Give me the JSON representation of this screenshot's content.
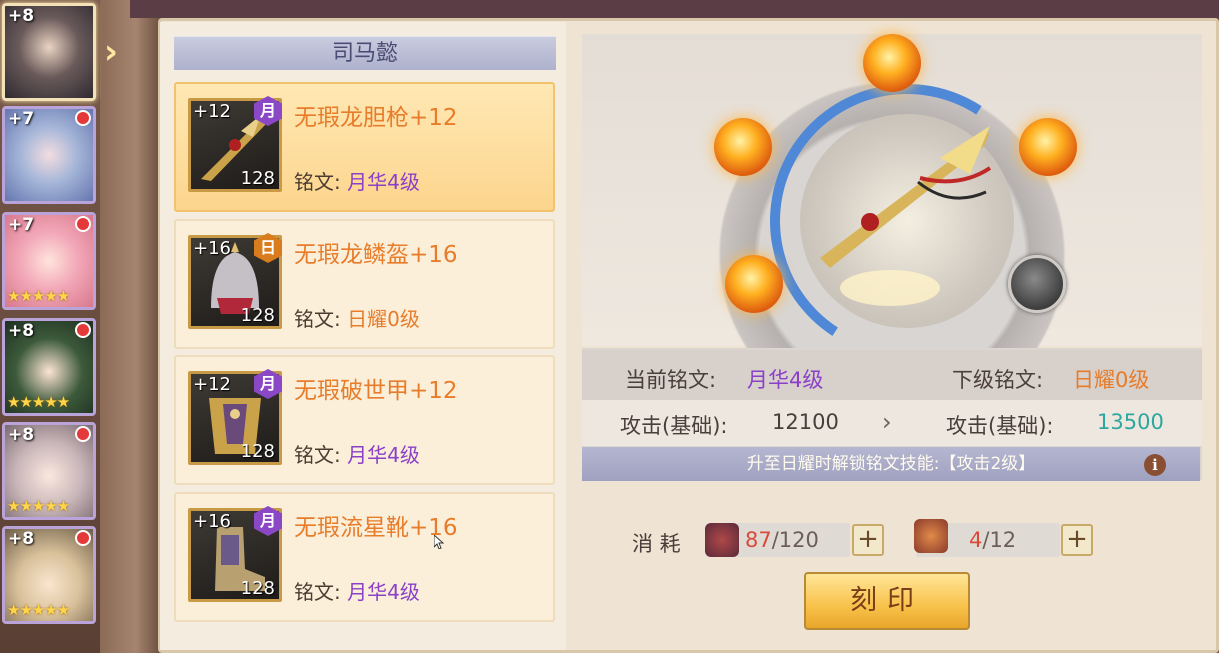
{
  "heroes": [
    {
      "level": "+8",
      "stars": "",
      "dot": false,
      "selected": true
    },
    {
      "level": "+7",
      "stars": "",
      "dot": true
    },
    {
      "level": "+7",
      "stars": "★★★★★",
      "dot": true
    },
    {
      "level": "+8",
      "stars": "★★★★★",
      "dot": true
    },
    {
      "level": "+8",
      "stars": "★★★★★",
      "dot": true
    },
    {
      "level": "+8",
      "stars": "★★★★★",
      "dot": true
    }
  ],
  "hero_name": "司马懿",
  "equipment": [
    {
      "plus": "+12",
      "badge": "月",
      "level": "128",
      "name": "无瑕龙胆枪+12",
      "rune_label": "铭文:",
      "rune_value": "月华4级"
    },
    {
      "plus": "+16",
      "badge": "日",
      "level": "128",
      "name": "无瑕龙鳞盔+16",
      "rune_label": "铭文:",
      "rune_value": "日耀0级"
    },
    {
      "plus": "+12",
      "badge": "月",
      "level": "128",
      "name": "无瑕破世甲+12",
      "rune_label": "铭文:",
      "rune_value": "月华4级"
    },
    {
      "plus": "+16",
      "badge": "月",
      "level": "128",
      "name": "无瑕流星靴+16",
      "rune_label": "铭文:",
      "rune_value": "月华4级"
    }
  ],
  "rune_info": {
    "current_label": "当前铭文:",
    "current_value": "月华4级",
    "next_label": "下级铭文:",
    "next_value": "日耀0级",
    "attack_label_left": "攻击(基础):",
    "attack_value_left": "12100",
    "attack_label_right": "攻击(基础):",
    "attack_value_right": "13500",
    "unlock_text": "升至日耀时解锁铭文技能:【攻击2级】"
  },
  "cost": {
    "label": "消 耗",
    "mat1_have": "87",
    "mat1_need": "/120",
    "mat2_have": "4",
    "mat2_need": "/12"
  },
  "engrave_button": "刻印",
  "colors": {
    "purple": "#8a40c9",
    "orange": "#e77c2a",
    "teal": "#2aa8a0"
  }
}
